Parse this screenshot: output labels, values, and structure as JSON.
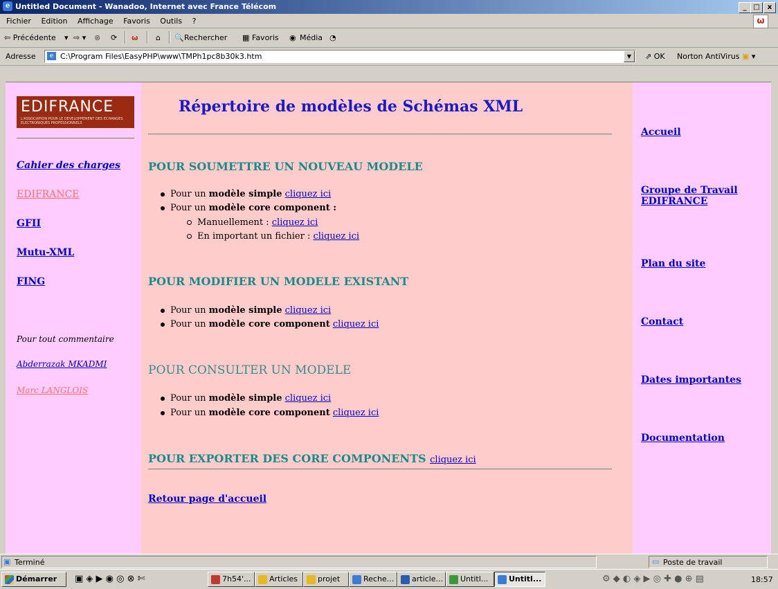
{
  "window": {
    "title": "Untitled Document - Wanadoo, Internet avec France Télécom",
    "min": "_",
    "max": "□",
    "close": "x"
  },
  "menu": [
    "Fichier",
    "Edition",
    "Affichage",
    "Favoris",
    "Outils",
    "?"
  ],
  "toolbar": {
    "back": "⇦ Précédente",
    "search": "Rechercher",
    "favorites": "Favoris",
    "media": "Média"
  },
  "address": {
    "label": "Adresse",
    "url": "C:\\Program Files\\EasyPHP\\www\\TMPh1pc8b30k3.htm",
    "go": "OK",
    "norton": "Norton AntiVirus"
  },
  "logo": {
    "name": "EDIFRANCE",
    "tagline": "L'ASSOCIATION POUR LE DEVELOPPEMENT DES ECHANGES ELECTRONIQUES PROFESSIONNELS"
  },
  "page": {
    "title": "Répertoire de modèles de Schémas XML",
    "left_links": [
      "Cahier des charges",
      "EDIFRANCE",
      "GFII",
      "Mutu-XML",
      "FING"
    ],
    "comment_label": "Pour tout commentaire",
    "contacts": [
      "Abderrazak MKADMI",
      "Marc LANGLOIS"
    ],
    "sections": {
      "submit": {
        "heading": "POUR SOUMETTRE UN NOUVEAU MODELE",
        "simple_prefix": "Pour un ",
        "simple_bold": "modèle simple",
        "core_prefix": "Pour un ",
        "core_bold": "modèle core component :",
        "manual": "Manuellement : ",
        "import": "En important un fichier : "
      },
      "modify": {
        "heading": "POUR MODIFIER UN MODELE EXISTANT",
        "simple_prefix": "Pour un ",
        "simple_bold": "modèle simple",
        "core_prefix": "Pour un ",
        "core_bold": "modèle core component"
      },
      "consult": {
        "heading": "POUR CONSULTER UN MODELE",
        "simple_prefix": "Pour un ",
        "simple_bold": "modèle simple",
        "core_prefix": "Pour un ",
        "core_bold": "modèle core component"
      },
      "export": {
        "heading": "POUR EXPORTER DES CORE COMPONENTS"
      }
    },
    "link_text": "cliquez ici",
    "back_home": "Retour page d'accueil",
    "right_links": [
      "Accueil",
      "Groupe de Travail EDIFRANCE",
      "Plan du site",
      "Contact",
      "Dates importantes",
      "Documentation"
    ]
  },
  "status": {
    "text": "Terminé",
    "zone": "Poste de travail"
  },
  "taskbar": {
    "start": "Démarrer",
    "tasks": [
      "7h54'...",
      "Articles",
      "projet",
      "Reche...",
      "article...",
      "Untitl...",
      "Untitl..."
    ],
    "clock": "18:57"
  }
}
